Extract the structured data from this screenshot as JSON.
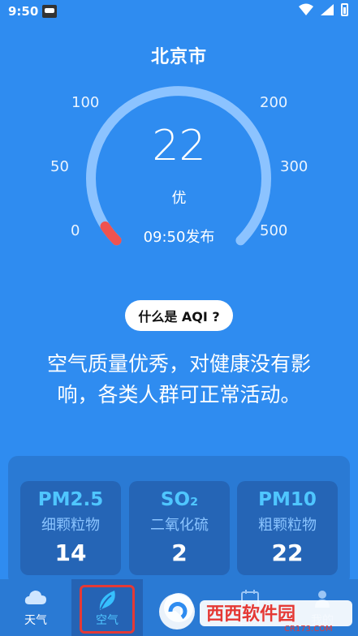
{
  "status_bar": {
    "time": "9:50"
  },
  "header": {
    "city": "北京市"
  },
  "gauge": {
    "scale_labels": [
      "0",
      "50",
      "100",
      "200",
      "300",
      "500"
    ],
    "aqi_value": "22",
    "aqi_level": "优",
    "publish_time": "09:50发布",
    "aqi_numeric": 22,
    "scale_max": 500,
    "colors": {
      "track": "#8cc3ff",
      "indicator": "#ef5350"
    }
  },
  "what_aqi_button": "什么是 AQI ?",
  "description": "空气质量优秀，对健康没有影响，各类人群可正常活动。",
  "pollutants": [
    {
      "name": "PM2.5",
      "desc": "细颗粒物",
      "value": "14"
    },
    {
      "name": "SO₂",
      "desc": "二氧化硫",
      "value": "2"
    },
    {
      "name": "PM10",
      "desc": "粗颗粒物",
      "value": "22"
    }
  ],
  "nav": [
    {
      "label": "天气",
      "icon": "cloud-icon"
    },
    {
      "label": "空气",
      "icon": "leaf-icon",
      "active": true
    },
    {
      "label": "",
      "icon": "speaker-icon"
    },
    {
      "label": "日历",
      "icon": "calendar-icon"
    },
    {
      "label": "我的",
      "icon": "user-icon"
    }
  ],
  "watermark": {
    "text": "西西软件园",
    "url_text": "CR173.COM"
  },
  "colors": {
    "background": "#2f8cf0",
    "accent": "#4fc6ff",
    "highlight": "#e53935"
  }
}
